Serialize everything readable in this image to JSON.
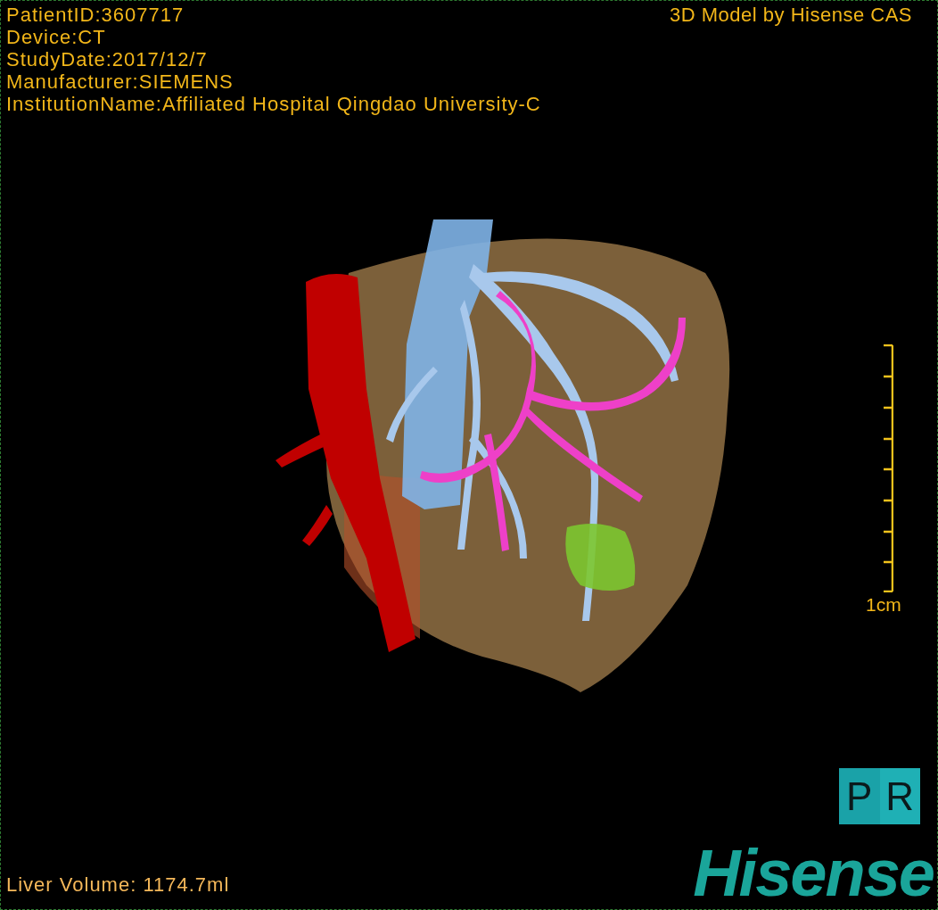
{
  "patient_info": [
    "PatientID:3607717",
    "Device:CT",
    "StudyDate:2017/12/7",
    "Manufacturer:SIEMENS",
    "InstitutionName:Affiliated Hospital Qingdao University-C"
  ],
  "title": "3D Model by Hisense CAS",
  "scale_bar": {
    "label": "1cm"
  },
  "view_button": {
    "letters": [
      "P",
      "R"
    ]
  },
  "logo": "Hisense",
  "liver_volume": "Liver Volume: 1174.7ml"
}
